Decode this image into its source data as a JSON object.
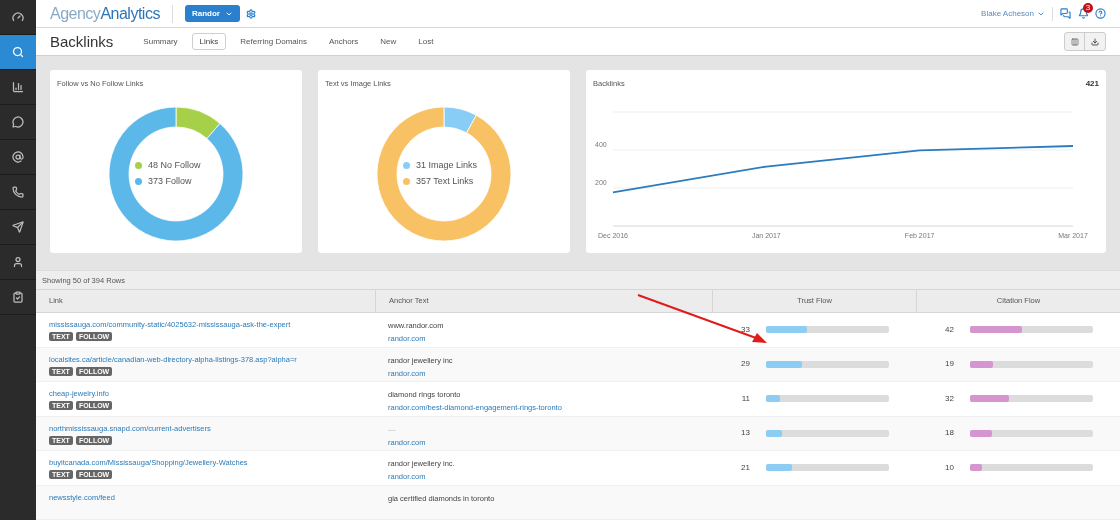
{
  "sidebar": {
    "items": [
      {
        "selected": false
      },
      {
        "selected": true
      },
      {
        "selected": false
      },
      {
        "selected": false
      },
      {
        "selected": false
      },
      {
        "selected": false
      },
      {
        "selected": false
      },
      {
        "selected": false
      },
      {
        "selected": false
      }
    ]
  },
  "header": {
    "logo": {
      "part_1": "Agency",
      "part_2": "Analytics"
    },
    "client": "Randor",
    "user": "Blake Acheson",
    "notifications": "3"
  },
  "page": {
    "title": "Backlinks",
    "tabs": [
      {
        "label": "Summary",
        "selected": false
      },
      {
        "label": "Links",
        "selected": true
      },
      {
        "label": "Referring Domains",
        "selected": false
      },
      {
        "label": "Anchors",
        "selected": false
      },
      {
        "label": "New",
        "selected": false
      },
      {
        "label": "Lost",
        "selected": false
      }
    ]
  },
  "cards": [
    {
      "title": "Follow vs No Follow Links",
      "chart_data": {
        "type": "donut",
        "categories": [
          "48 No Follow",
          "373 Follow"
        ],
        "values": [
          48,
          373
        ],
        "colors": [
          "#a6d04a",
          "#5bb8e8"
        ],
        "legend": "center"
      }
    },
    {
      "title": "Text vs Image Links",
      "chart_data": {
        "type": "donut",
        "categories": [
          "31 Image Links",
          "357 Text Links"
        ],
        "values": [
          31,
          357
        ],
        "colors": [
          "#88cdf6",
          "#f8c163"
        ],
        "legend": "center"
      }
    },
    {
      "title": "Backlinks",
      "total": "421",
      "chart_data": {
        "type": "line",
        "x": [
          "Dec 2016",
          "Jan 2017",
          "Feb 2017",
          "Mar 2017"
        ],
        "values": [
          177,
          313,
          398,
          421
        ],
        "color": "#2a7bbf",
        "ylim": [
          0,
          600
        ],
        "yticks": [
          200,
          400
        ]
      }
    }
  ],
  "table": {
    "summary": "Showing 50 of 394 Rows",
    "columns": [
      "Link",
      "Anchor Text",
      "Trust Flow",
      "Citation Flow"
    ],
    "rows": [
      {
        "link": "mississauga.com/community-static/4025632-mississauga-ask-the-expert",
        "tags": [
          "TEXT",
          "FOLLOW"
        ],
        "anchor": [
          {
            "kind": "plain",
            "text": "www.randor.com"
          },
          {
            "kind": "link",
            "text": "randor.com"
          }
        ],
        "trust": {
          "value": "33",
          "level": 0.33
        },
        "citation": {
          "value": "42",
          "level": 0.42
        }
      },
      {
        "link": "localsites.ca/article/canadian-web-directory-alpha-listings-378.asp?alpha=r",
        "tags": [
          "TEXT",
          "FOLLOW"
        ],
        "anchor": [
          {
            "kind": "plain",
            "text": "randor jewellery inc"
          },
          {
            "kind": "link",
            "text": "randor.com"
          }
        ],
        "trust": {
          "value": "29",
          "level": 0.29
        },
        "citation": {
          "value": "19",
          "level": 0.19
        }
      },
      {
        "link": "cheap-jewelry.info",
        "tags": [
          "TEXT",
          "FOLLOW"
        ],
        "anchor": [
          {
            "kind": "plain",
            "text": "diamond rings toronto"
          },
          {
            "kind": "link",
            "text": "randor.com/best-diamond-engagement-rings-toronto"
          }
        ],
        "trust": {
          "value": "11",
          "level": 0.11
        },
        "citation": {
          "value": "32",
          "level": 0.32
        }
      },
      {
        "link": "northmississauga.snapd.com/current-advertisers",
        "tags": [
          "TEXT",
          "FOLLOW"
        ],
        "anchor": [
          {
            "kind": "empty",
            "text": "—"
          },
          {
            "kind": "link",
            "text": "randor.com"
          }
        ],
        "trust": {
          "value": "13",
          "level": 0.13
        },
        "citation": {
          "value": "18",
          "level": 0.18
        }
      },
      {
        "link": "buyitcanada.com/Mississauga/Shopping/Jewellery-Watches",
        "tags": [
          "TEXT",
          "FOLLOW"
        ],
        "anchor": [
          {
            "kind": "plain",
            "text": "randor jewellery inc."
          },
          {
            "kind": "link",
            "text": "randor.com"
          }
        ],
        "trust": {
          "value": "21",
          "level": 0.21
        },
        "citation": {
          "value": "10",
          "level": 0.1
        }
      },
      {
        "link": "newsstyle.com/feed",
        "tags": [],
        "anchor": [
          {
            "kind": "plain",
            "text": "gia certified diamonds in toronto"
          }
        ]
      }
    ]
  }
}
